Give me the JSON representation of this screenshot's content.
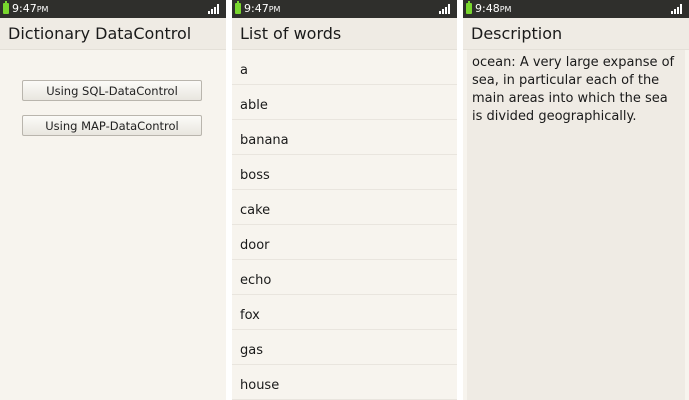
{
  "screens": [
    {
      "status": {
        "time": "9:47",
        "ampm": "PM"
      },
      "title": "Dictionary DataControl",
      "buttons": [
        "Using SQL-DataControl",
        "Using MAP-DataControl"
      ]
    },
    {
      "status": {
        "time": "9:47",
        "ampm": "PM"
      },
      "title": "List of words",
      "words": [
        "a",
        "able",
        "banana",
        "boss",
        "cake",
        "door",
        "echo",
        "fox",
        "gas",
        "house"
      ]
    },
    {
      "status": {
        "time": "9:48",
        "ampm": "PM"
      },
      "title": "Description",
      "description": "ocean: A very large expanse of sea, in particular each of the main areas into which the sea is divided geographically."
    }
  ],
  "colors": {
    "status_bar": "#2f2f2c",
    "battery": "#79d72e",
    "background": "#f7f4ee",
    "title_bar": "#efebe4"
  },
  "icons": [
    "battery-icon",
    "signal-icon"
  ]
}
